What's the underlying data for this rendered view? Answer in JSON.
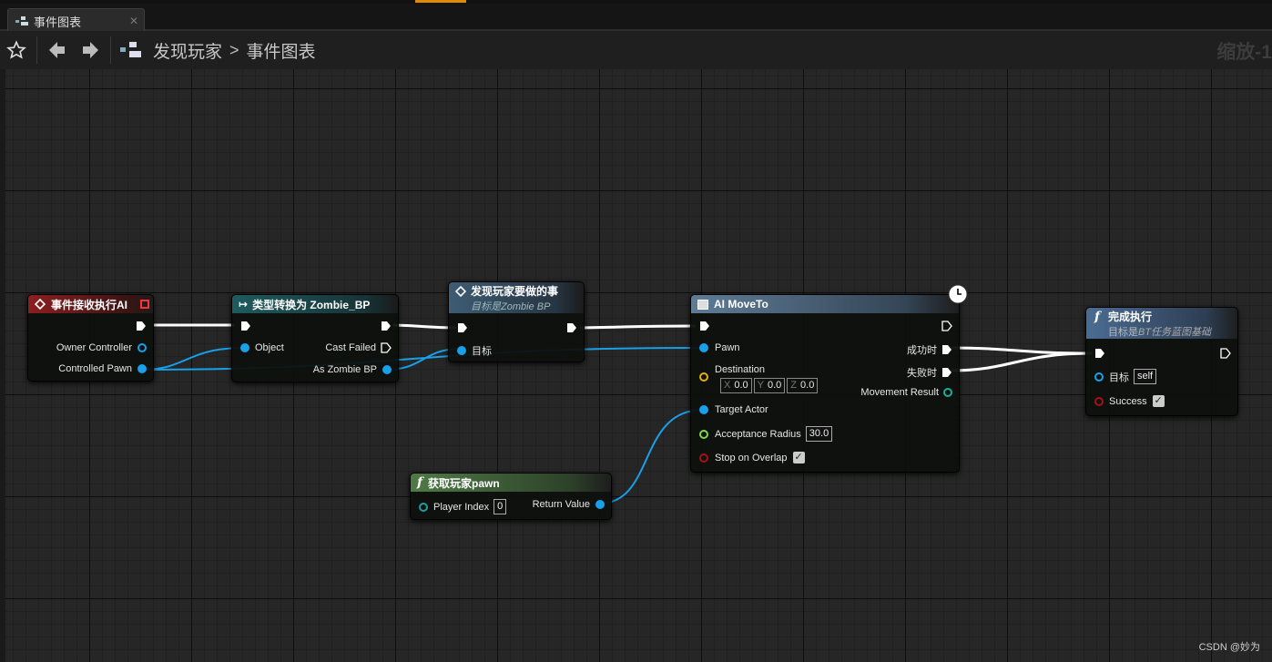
{
  "tab": {
    "label": "事件图表",
    "close": "✕"
  },
  "toolbar": {
    "breadcrumb_root": "发现玩家",
    "breadcrumb_sep": ">",
    "breadcrumb_current": "事件图表",
    "zoom_text": "缩放-1"
  },
  "nodes": {
    "event": {
      "title": "事件接收执行AI",
      "pins": {
        "owner_controller": "Owner Controller",
        "controlled_pawn": "Controlled Pawn"
      }
    },
    "cast": {
      "title": "类型转换为 Zombie_BP",
      "pins": {
        "object": "Object",
        "cast_failed": "Cast Failed",
        "as_zombie_bp": "As Zombie BP"
      }
    },
    "custom": {
      "title": "发现玩家要做的事",
      "subtitle": "目标是Zombie BP",
      "pins": {
        "target": "目标"
      }
    },
    "moveto": {
      "title": "AI MoveTo",
      "pins": {
        "pawn": "Pawn",
        "destination": "Destination",
        "dest_x_label": "X",
        "dest_x": "0.0",
        "dest_y_label": "Y",
        "dest_y": "0.0",
        "dest_z_label": "Z",
        "dest_z": "0.0",
        "target_actor": "Target Actor",
        "acceptance_radius": "Acceptance Radius",
        "acceptance_radius_value": "30.0",
        "stop_on_overlap": "Stop on Overlap",
        "on_success": "成功时",
        "on_fail": "失败时",
        "movement_result": "Movement Result"
      }
    },
    "finish": {
      "title": "完成执行",
      "subtitle_prefix": "目标是",
      "subtitle_rest": "BT任务蓝图基础",
      "pins": {
        "target": "目标",
        "target_value": "self",
        "success": "Success"
      }
    },
    "getpawn": {
      "title": "获取玩家pawn",
      "pins": {
        "player_index": "Player Index",
        "player_index_value": "0",
        "return_value": "Return Value"
      }
    }
  },
  "checkbox_mark": "✓",
  "watermark": "CSDN @妙为",
  "colors": {
    "exec_wire": "#ffffff",
    "object_wire": "#18a0e8",
    "event_header": "#8c1f1f",
    "cast_header": "#1e5b5e",
    "pure_header": "#4f7a46",
    "function_header": "#4b6c92",
    "accent_orange": "#e08a00"
  },
  "icons": [
    "star-icon",
    "back-arrow-icon",
    "forward-arrow-icon",
    "graph-icon",
    "event-diamond-icon",
    "cast-arrow-icon",
    "function-icon",
    "latent-clock-icon",
    "delegate-square-icon",
    "exec-pin-icon"
  ]
}
